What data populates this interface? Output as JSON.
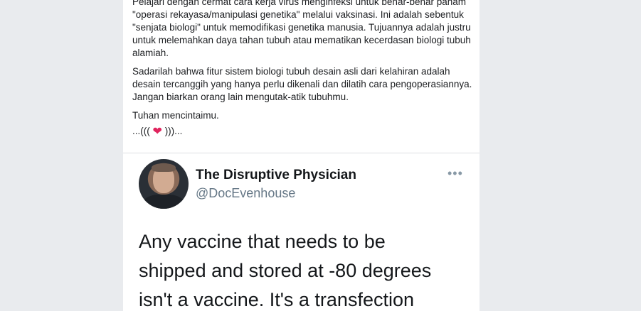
{
  "post": {
    "paragraphs": [
      "Pelajari dengan cermat cara kerja virus menginfeksi untuk benar-benar paham \"operasi rekayasa/manipulasi genetika\" melalui vaksinasi. Ini adalah sebentuk \"senjata biologi\" untuk memodifikasi genetika manusia. Tujuannya adalah justru untuk melemahkan daya tahan tubuh atau mematikan kecerdasan biologi tubuh alamiah.",
      "Sadarilah bahwa fitur sistem biologi tubuh desain asli dari kelahiran adalah desain tercanggih yang hanya perlu dikenali dan dilatih cara pengoperasiannya. Jangan biarkan orang lain mengutak-atik tubuhmu.",
      "Tuhan mencintaimu."
    ],
    "signoff_prefix": "...(((",
    "signoff_heart": "❤",
    "signoff_suffix": ")))..."
  },
  "tweet": {
    "display_name": "The Disruptive Physician",
    "handle": "@DocEvenhouse",
    "more_icon": "•••",
    "body_lines": [
      "Any vaccine that needs to be",
      "shipped and stored at -80 degrees",
      "isn't a vaccine. It's a transfection"
    ]
  }
}
